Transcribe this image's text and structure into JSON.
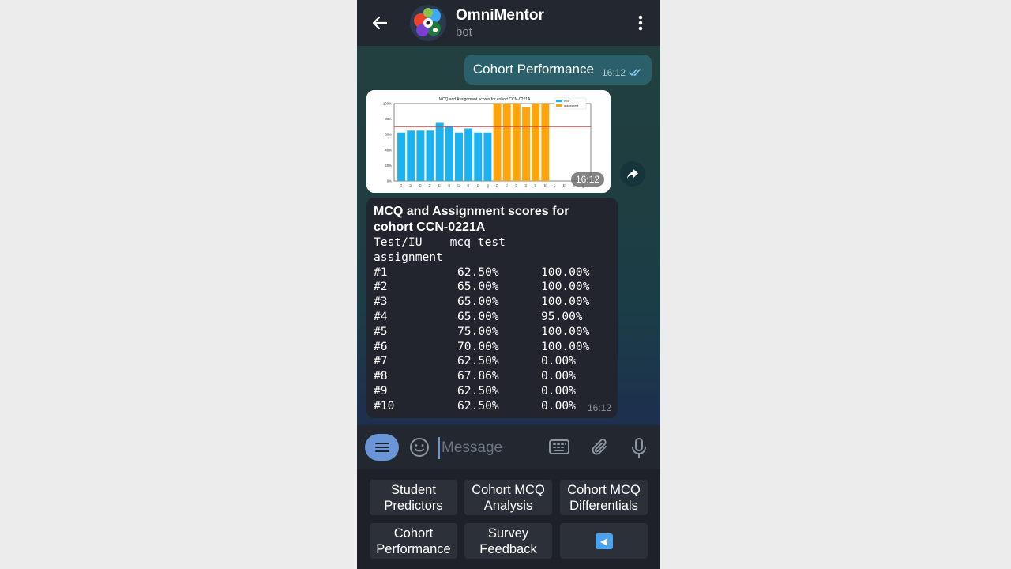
{
  "header": {
    "title": "OmniMentor",
    "subtitle": "bot"
  },
  "outgoing": {
    "text": "Cohort Performance",
    "time": "16:12"
  },
  "photo": {
    "time": "16:12"
  },
  "chart_data": {
    "type": "bar",
    "title": "MCQ and Assignment scores for cohort CCN-0221A",
    "legend": [
      "mcq",
      "assignment"
    ],
    "legend_position": "top-right",
    "yticks": [
      "0%",
      "20%",
      "40%",
      "60%",
      "80%",
      "100%"
    ],
    "ylim": [
      0,
      100
    ],
    "threshold": 70,
    "mcq": [
      62.5,
      65,
      65,
      65,
      75,
      70,
      62.5,
      67.86,
      62.5,
      62.5
    ],
    "assignment": [
      100,
      100,
      100,
      95,
      100,
      100,
      0,
      0,
      0,
      0
    ],
    "colors": {
      "mcq": "#1ab2ef",
      "assignment": "#ffa40a",
      "threshold": "#e33b3b"
    }
  },
  "report": {
    "title": "MCQ and Assignment scores for cohort CCN-0221A",
    "header_line1": "Test/IU    mcq test",
    "header_line2": "assignment",
    "rows": [
      [
        "#1",
        "62.50%",
        "100.00%"
      ],
      [
        "#2",
        "65.00%",
        "100.00%"
      ],
      [
        "#3",
        "65.00%",
        "100.00%"
      ],
      [
        "#4",
        "65.00%",
        "95.00%"
      ],
      [
        "#5",
        "75.00%",
        "100.00%"
      ],
      [
        "#6",
        "70.00%",
        "100.00%"
      ],
      [
        "#7",
        "62.50%",
        "0.00%"
      ],
      [
        "#8",
        "67.86%",
        "0.00%"
      ],
      [
        "#9",
        "62.50%",
        "0.00%"
      ],
      [
        "#10",
        "62.50%",
        "0.00%"
      ]
    ],
    "time": "16:12"
  },
  "composer": {
    "placeholder": "Message"
  },
  "keyboard": {
    "buttons": [
      "Student Predictors",
      "Cohort MCQ Analysis",
      "Cohort MCQ Differentials",
      "Cohort Performance",
      "Survey Feedback",
      "◀"
    ]
  }
}
